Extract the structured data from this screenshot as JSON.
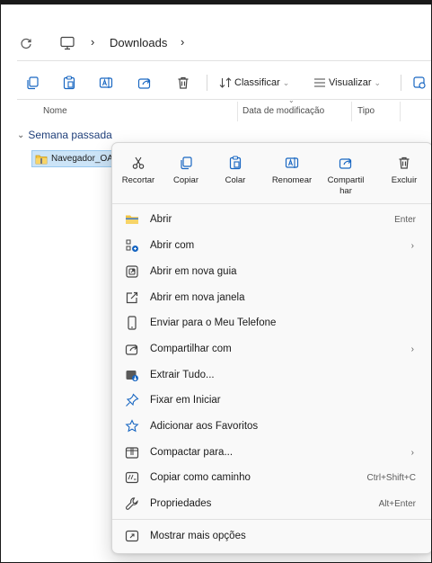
{
  "address": {
    "folder": "Downloads",
    "separator": "›"
  },
  "toolbar": {
    "sort_label": "Classificar",
    "view_label": "Visualizar"
  },
  "columns": {
    "name": "Nome",
    "modified": "Data de modificação",
    "type": "Tipo"
  },
  "group": {
    "label": "Semana passada"
  },
  "file": {
    "name": "Navegador_OA"
  },
  "quick_actions": [
    {
      "label": "Recortar",
      "icon": "cut-icon"
    },
    {
      "label": "Copiar",
      "icon": "copy-icon"
    },
    {
      "label": "Colar",
      "icon": "paste-icon"
    },
    {
      "label": "Renomear",
      "icon": "rename-icon"
    },
    {
      "label": "Compartil\nhar",
      "icon": "share-icon"
    },
    {
      "label": "Excluir",
      "icon": "delete-icon"
    }
  ],
  "menu_items": [
    {
      "label": "Abrir",
      "icon": "folder-icon",
      "shortcut": "Enter"
    },
    {
      "label": "Abrir com",
      "icon": "open-with-icon",
      "arrow": "›"
    },
    {
      "label": "Abrir em nova guia",
      "icon": "new-tab-icon"
    },
    {
      "label": "Abrir em nova janela",
      "icon": "new-window-icon"
    },
    {
      "label": "Enviar para o Meu Telefone",
      "icon": "phone-icon"
    },
    {
      "label": "Compartilhar com",
      "icon": "share-icon",
      "arrow": "›"
    },
    {
      "label": "Extrair Tudo...",
      "icon": "extract-icon"
    },
    {
      "label": "Fixar em Iniciar",
      "icon": "pin-icon"
    },
    {
      "label": "Adicionar aos Favoritos",
      "icon": "star-icon"
    },
    {
      "label": "Compactar para...",
      "icon": "compress-icon",
      "arrow": "›"
    },
    {
      "label": "Copiar como caminho",
      "icon": "copy-path-icon",
      "shortcut": "Ctrl+Shift+C"
    },
    {
      "label": "Propriedades",
      "icon": "wrench-icon",
      "shortcut": "Alt+Enter"
    }
  ],
  "more_options": {
    "label": "Mostrar mais opções",
    "icon": "more-options-icon"
  }
}
